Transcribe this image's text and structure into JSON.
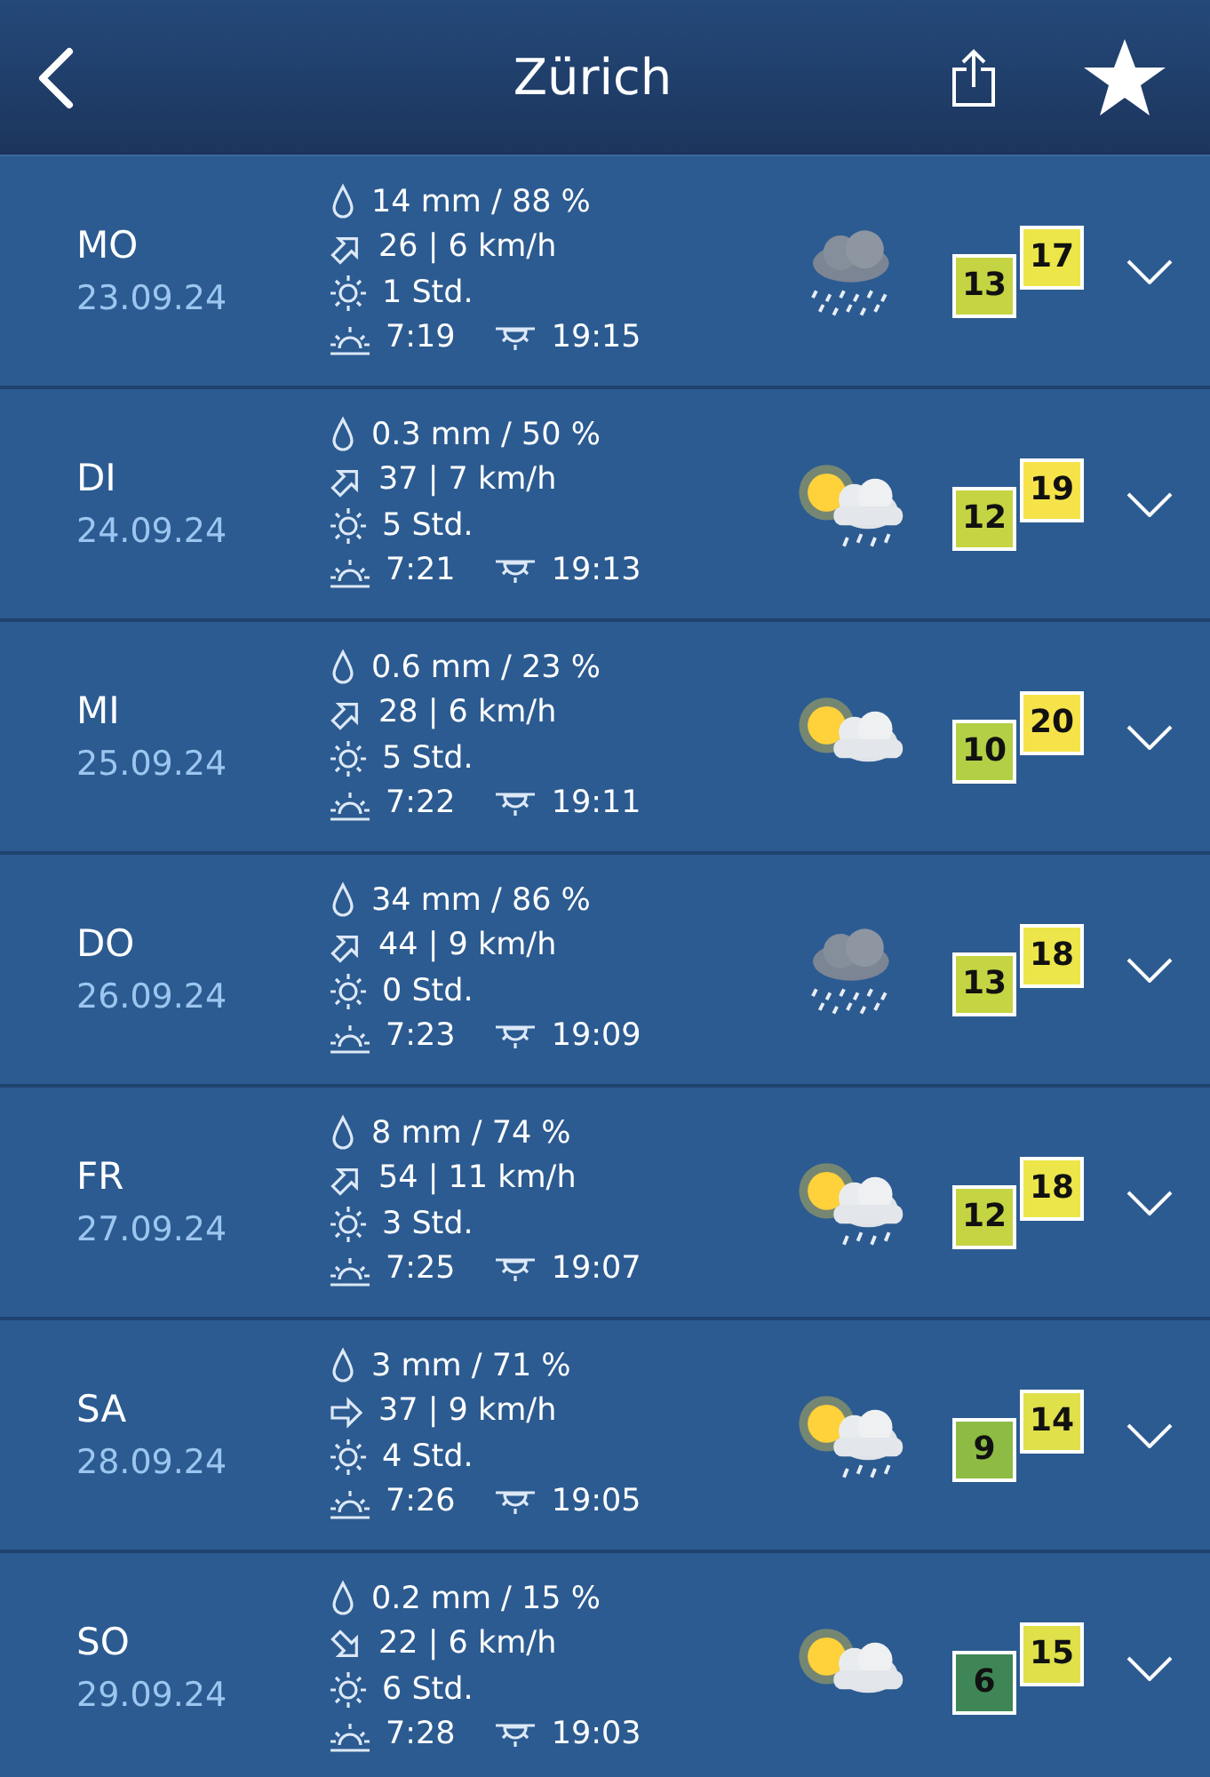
{
  "header": {
    "title": "Zürich"
  },
  "days": [
    {
      "day": "MO",
      "date": "23.09.24",
      "precip": "14 mm / 88 %",
      "wind": {
        "kind": "northeast",
        "text": "26  |  6 km/h"
      },
      "sun": "1 Std.",
      "sunrise": "7:19",
      "sunset": "19:15",
      "weather": {
        "kind": "rain"
      },
      "temps": [
        {
          "kind": "min",
          "value": "13",
          "color": "#c5d443"
        },
        {
          "kind": "max",
          "value": "17",
          "color": "#ece64a"
        }
      ]
    },
    {
      "day": "DI",
      "date": "24.09.24",
      "precip": "0.3 mm / 50 %",
      "wind": {
        "kind": "northeast",
        "text": "37  |  7 km/h"
      },
      "sun": "5 Std.",
      "sunrise": "7:21",
      "sunset": "19:13",
      "weather": {
        "kind": "suncloudrain"
      },
      "temps": [
        {
          "kind": "min",
          "value": "12",
          "color": "#c5d443"
        },
        {
          "kind": "max",
          "value": "19",
          "color": "#f6e34a"
        }
      ]
    },
    {
      "day": "MI",
      "date": "25.09.24",
      "precip": "0.6 mm / 23 %",
      "wind": {
        "kind": "northeast",
        "text": "28  |  6 km/h"
      },
      "sun": "5 Std.",
      "sunrise": "7:22",
      "sunset": "19:11",
      "weather": {
        "kind": "suncloud"
      },
      "temps": [
        {
          "kind": "min",
          "value": "10",
          "color": "#b3cf46"
        },
        {
          "kind": "max",
          "value": "20",
          "color": "#f6e34a"
        }
      ]
    },
    {
      "day": "DO",
      "date": "26.09.24",
      "precip": "34 mm / 86 %",
      "wind": {
        "kind": "northeast",
        "text": "44  |  9 km/h"
      },
      "sun": "0 Std.",
      "sunrise": "7:23",
      "sunset": "19:09",
      "weather": {
        "kind": "rain"
      },
      "temps": [
        {
          "kind": "min",
          "value": "13",
          "color": "#c5d443"
        },
        {
          "kind": "max",
          "value": "18",
          "color": "#ece64a"
        }
      ]
    },
    {
      "day": "FR",
      "date": "27.09.24",
      "precip": "8 mm / 74 %",
      "wind": {
        "kind": "northeast",
        "text": "54  |  11 km/h"
      },
      "sun": "3 Std.",
      "sunrise": "7:25",
      "sunset": "19:07",
      "weather": {
        "kind": "suncloudrain"
      },
      "temps": [
        {
          "kind": "min",
          "value": "12",
          "color": "#c5d443"
        },
        {
          "kind": "max",
          "value": "18",
          "color": "#ece64a"
        }
      ]
    },
    {
      "day": "SA",
      "date": "28.09.24",
      "precip": "3 mm / 71 %",
      "wind": {
        "kind": "east",
        "text": "37  |  9 km/h"
      },
      "sun": "4 Std.",
      "sunrise": "7:26",
      "sunset": "19:05",
      "weather": {
        "kind": "suncloudrain"
      },
      "temps": [
        {
          "kind": "min",
          "value": "9",
          "color": "#8dbb44"
        },
        {
          "kind": "max",
          "value": "14",
          "color": "#dfe04a"
        }
      ]
    },
    {
      "day": "SO",
      "date": "29.09.24",
      "precip": "0.2 mm / 15 %",
      "wind": {
        "kind": "southeast",
        "text": "22  |  6 km/h"
      },
      "sun": "6 Std.",
      "sunrise": "7:28",
      "sunset": "19:03",
      "weather": {
        "kind": "suncloud"
      },
      "temps": [
        {
          "kind": "min",
          "value": "6",
          "color": "#3e8656"
        },
        {
          "kind": "max",
          "value": "15",
          "color": "#dfe04a"
        }
      ]
    }
  ]
}
